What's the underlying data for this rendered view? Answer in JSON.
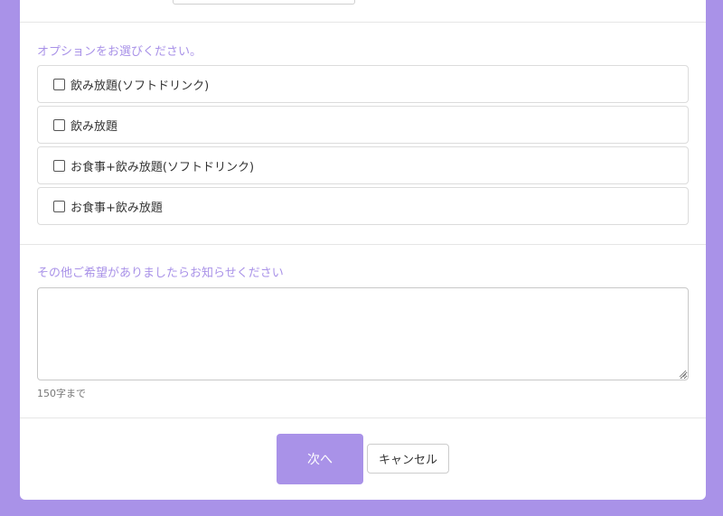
{
  "options_section": {
    "label": "オプションをお選びください。",
    "options": [
      {
        "label": "飲み放題(ソフトドリンク)",
        "checked": false
      },
      {
        "label": "飲み放題",
        "checked": false
      },
      {
        "label": "お食事+飲み放題(ソフトドリンク)",
        "checked": false
      },
      {
        "label": "お食事+飲み放題",
        "checked": false
      }
    ]
  },
  "comments_section": {
    "label": "その他ご希望がありましたらお知らせください",
    "value": "",
    "hint": "150字まで"
  },
  "actions": {
    "next_label": "次へ",
    "cancel_label": "キャンセル"
  },
  "colors": {
    "accent": "#a992e8",
    "background": "#a992e8",
    "card": "#ffffff"
  }
}
